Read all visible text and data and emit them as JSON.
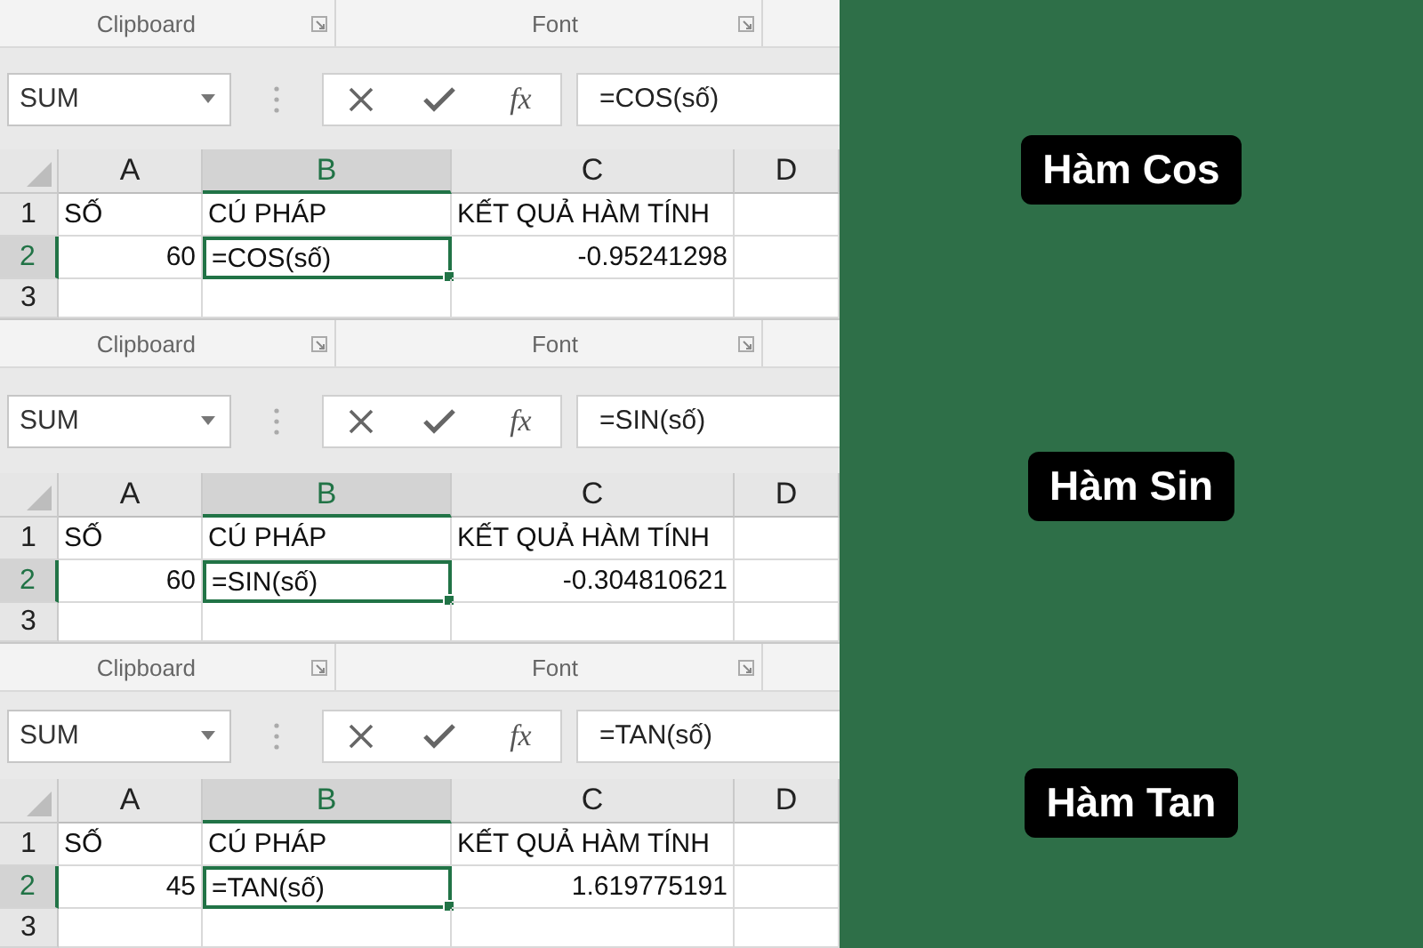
{
  "panels": [
    {
      "ribbon_groups": [
        "Clipboard",
        "Font"
      ],
      "name_box": "SUM",
      "function_button": "fx",
      "formula": "=COS(số)",
      "columns": [
        {
          "label": "A",
          "selected": false
        },
        {
          "label": "B",
          "selected": true
        },
        {
          "label": "C",
          "selected": false
        },
        {
          "label": "D",
          "selected": false
        }
      ],
      "rows": [
        {
          "header": "1",
          "selected": false,
          "cells": [
            {
              "text": "SỐ",
              "kind": "text",
              "selected": false
            },
            {
              "text": "CÚ PHÁP",
              "kind": "text",
              "selected": false
            },
            {
              "text": "KẾT QUẢ HÀM TÍNH",
              "kind": "text",
              "selected": false
            }
          ]
        },
        {
          "header": "2",
          "selected": true,
          "cells": [
            {
              "text": "60",
              "kind": "number",
              "selected": false
            },
            {
              "text": "=COS(số)",
              "kind": "text",
              "selected": true
            },
            {
              "text": "-0.95241298",
              "kind": "number",
              "selected": false
            }
          ]
        },
        {
          "header": "3",
          "selected": false
        }
      ]
    },
    {
      "ribbon_groups": [
        "Clipboard",
        "Font"
      ],
      "name_box": "SUM",
      "function_button": "fx",
      "formula": "=SIN(số)",
      "columns": [
        {
          "label": "A",
          "selected": false
        },
        {
          "label": "B",
          "selected": true
        },
        {
          "label": "C",
          "selected": false
        },
        {
          "label": "D",
          "selected": false
        }
      ],
      "rows": [
        {
          "header": "1",
          "selected": false,
          "cells": [
            {
              "text": "SỐ",
              "kind": "text",
              "selected": false
            },
            {
              "text": "CÚ PHÁP",
              "kind": "text",
              "selected": false
            },
            {
              "text": "KẾT QUẢ HÀM TÍNH",
              "kind": "text",
              "selected": false
            }
          ]
        },
        {
          "header": "2",
          "selected": true,
          "cells": [
            {
              "text": "60",
              "kind": "number",
              "selected": false
            },
            {
              "text": "=SIN(số)",
              "kind": "text",
              "selected": true
            },
            {
              "text": "-0.304810621",
              "kind": "number",
              "selected": false
            }
          ]
        },
        {
          "header": "3",
          "selected": false
        }
      ]
    },
    {
      "ribbon_groups": [
        "Clipboard",
        "Font"
      ],
      "name_box": "SUM",
      "function_button": "fx",
      "formula": "=TAN(số)",
      "columns": [
        {
          "label": "A",
          "selected": false
        },
        {
          "label": "B",
          "selected": true
        },
        {
          "label": "C",
          "selected": false
        },
        {
          "label": "D",
          "selected": false
        }
      ],
      "rows": [
        {
          "header": "1",
          "selected": false,
          "cells": [
            {
              "text": "SỐ",
              "kind": "text",
              "selected": false
            },
            {
              "text": "CÚ PHÁP",
              "kind": "text",
              "selected": false
            },
            {
              "text": "KẾT QUẢ HÀM TÍNH",
              "kind": "text",
              "selected": false
            }
          ]
        },
        {
          "header": "2",
          "selected": true,
          "cells": [
            {
              "text": "45",
              "kind": "number",
              "selected": false
            },
            {
              "text": "=TAN(số)",
              "kind": "text",
              "selected": true
            },
            {
              "text": "1.619775191",
              "kind": "number",
              "selected": false
            }
          ]
        },
        {
          "header": "3",
          "selected": false
        }
      ]
    }
  ],
  "labels": [
    "Hàm Cos",
    "Hàm Sin",
    "Hàm Tan"
  ]
}
